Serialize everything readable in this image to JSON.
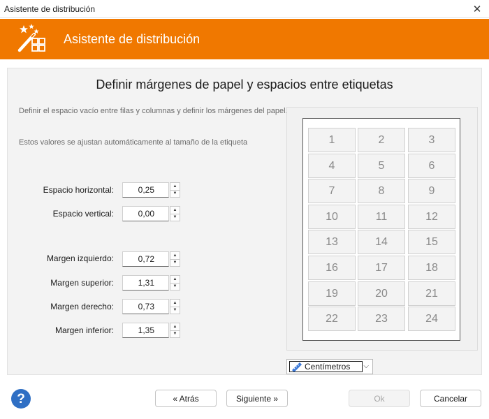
{
  "window": {
    "title": "Asistente de distribución",
    "close_glyph": "✕"
  },
  "banner": {
    "title": "Asistente de distribución",
    "icon": "magic-wand-labels-icon",
    "color": "#f07800"
  },
  "page": {
    "heading": "Definir márgenes de papel y espacios entre etiquetas",
    "description_1": "Definir el espacio vacío entre filas y columnas y definir los márgenes del papel.",
    "description_2": "Estos valores se ajustan automáticamente al tamaño de la etiqueta"
  },
  "fields": {
    "horizontal_spacing": {
      "label": "Espacio horizontal:",
      "value": "0,25"
    },
    "vertical_spacing": {
      "label": "Espacio vertical:",
      "value": "0,00"
    },
    "margin_left": {
      "label": "Margen izquierdo:",
      "value": "0,72"
    },
    "margin_top": {
      "label": "Margen superior:",
      "value": "1,31"
    },
    "margin_right": {
      "label": "Margen derecho:",
      "value": "0,73"
    },
    "margin_bottom": {
      "label": "Margen inferior:",
      "value": "1,35"
    }
  },
  "spinner": {
    "up": "▲",
    "down": "▼"
  },
  "preview": {
    "labels": [
      "1",
      "2",
      "3",
      "4",
      "5",
      "6",
      "7",
      "8",
      "9",
      "10",
      "11",
      "12",
      "13",
      "14",
      "15",
      "16",
      "17",
      "18",
      "19",
      "20",
      "21",
      "22",
      "23",
      "24"
    ]
  },
  "units": {
    "selected": "Centímetros",
    "icon": "ruler-icon",
    "chevron": "⌵"
  },
  "buttons": {
    "back": "« Atrás",
    "next": "Siguiente »",
    "ok": "Ok",
    "cancel": "Cancelar"
  }
}
